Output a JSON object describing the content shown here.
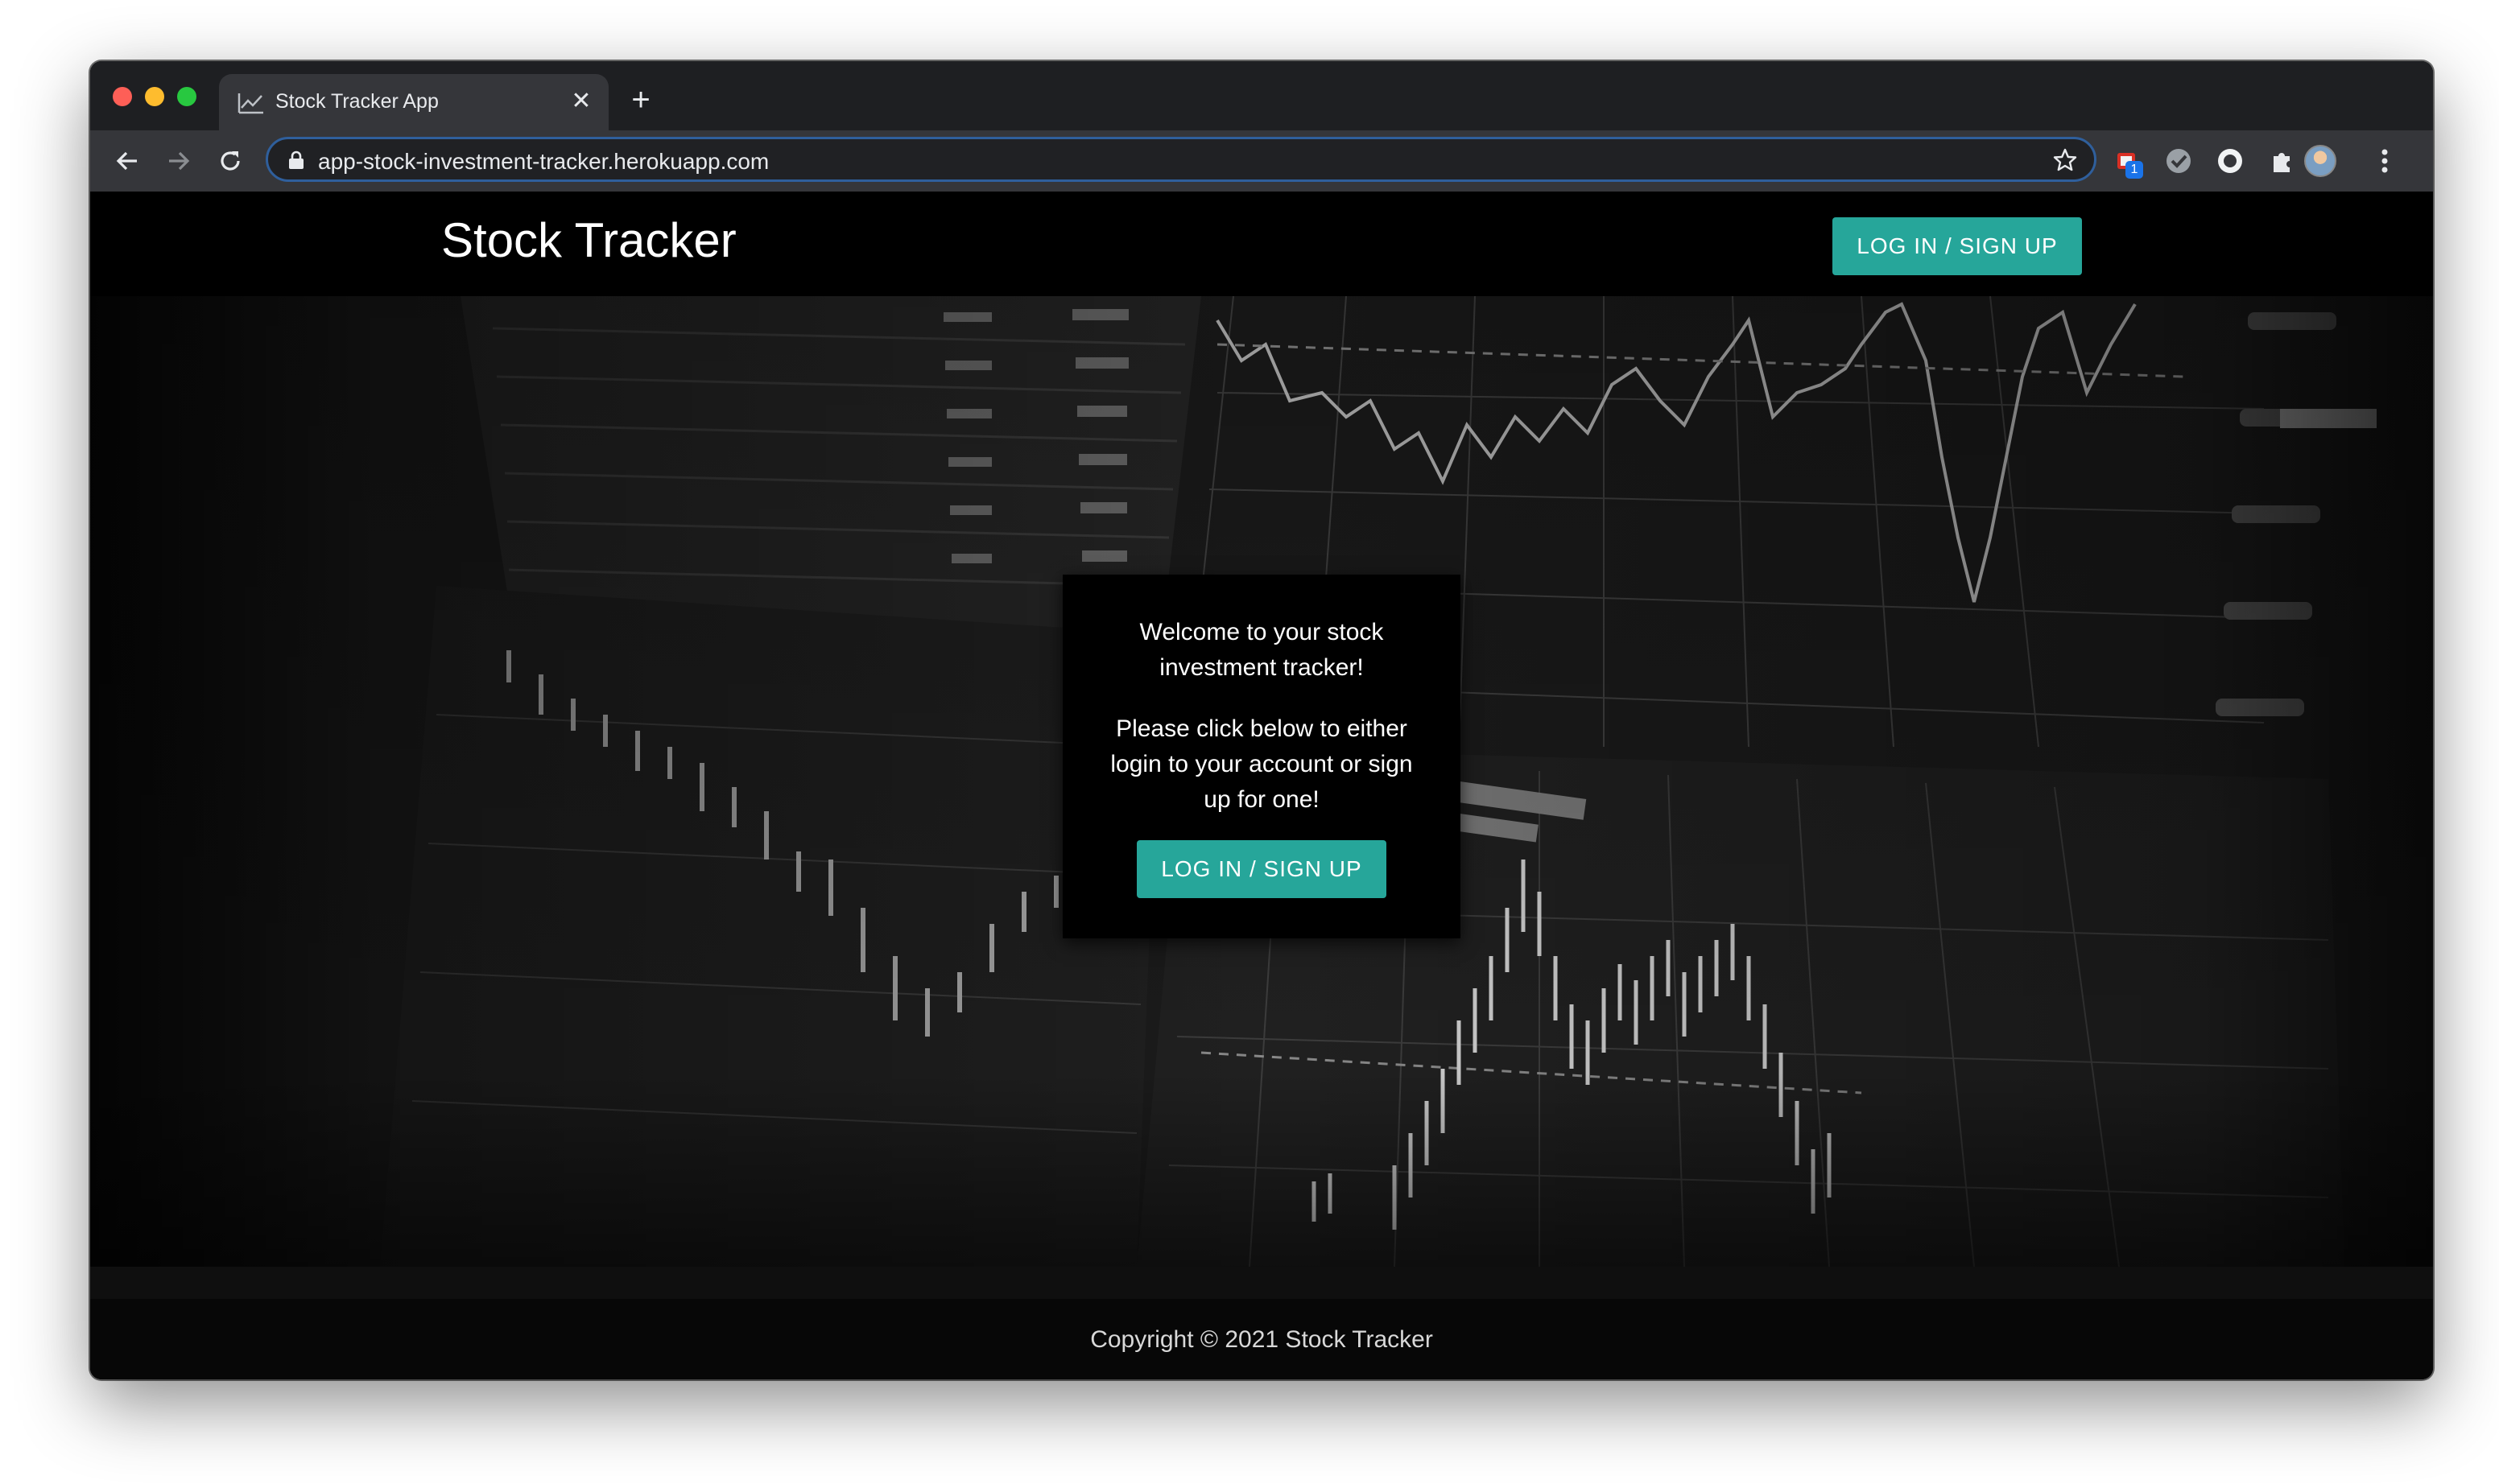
{
  "browser": {
    "tab_title": "Stock Tracker App",
    "url": "app-stock-investment-tracker.herokuapp.com",
    "extension_badge": "1",
    "icons": [
      "chart-favicon-icon",
      "back-icon",
      "forward-icon",
      "reload-icon",
      "lock-icon",
      "star-icon",
      "extension-icon",
      "puzzle-icon",
      "more-vert-icon"
    ]
  },
  "header": {
    "brand": "Stock Tracker",
    "login_button": "LOG IN / SIGN UP"
  },
  "welcome": {
    "message": "Welcome to your stock investment tracker!",
    "instruction": "Please click below to either login to your account or sign up for one!",
    "button": "LOG IN / SIGN UP"
  },
  "footer": {
    "copyright": "Copyright © 2021 Stock Tracker"
  },
  "colors": {
    "accent": "#26a69a",
    "header_bg": "#000000",
    "tab_bg": "#35363a"
  }
}
